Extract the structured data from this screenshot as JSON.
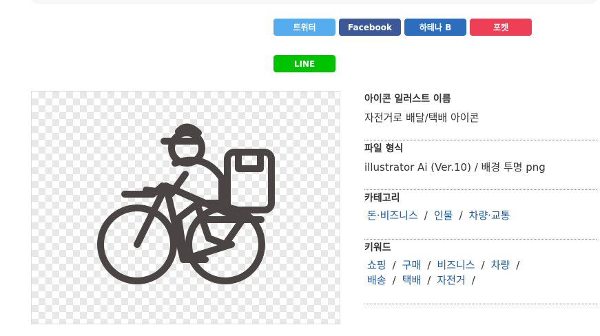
{
  "share": {
    "twitter": {
      "label": "트위터",
      "color": "#55acee"
    },
    "facebook": {
      "label": "Facebook",
      "color": "#3b5998"
    },
    "hatena": {
      "label": "하테나 B",
      "color": "#2c6ebd"
    },
    "pocket": {
      "label": "포켓",
      "color": "#ef3f56"
    },
    "line": {
      "label": "LINE",
      "color": "#00c300"
    }
  },
  "image": {
    "icon_name": "delivery-bicycle-icon",
    "icon_color": "#4a4544"
  },
  "info": {
    "name_heading": "아이콘 일러스트 이름",
    "name_value": "자전거로 배달/택배 아이콘",
    "format_heading": "파일 형식",
    "format_value": "illustrator Ai (Ver.10) /   배경 투명 png",
    "category_heading": "카테고리",
    "categories": [
      "돈·비즈니스",
      "인물",
      "차량·교통"
    ],
    "keyword_heading": "키워드",
    "keywords_line1": [
      "쇼핑",
      "구매",
      "비즈니스",
      "차량"
    ],
    "keywords_line2": [
      "배송",
      "택배",
      "자전거"
    ],
    "separator": "/"
  }
}
